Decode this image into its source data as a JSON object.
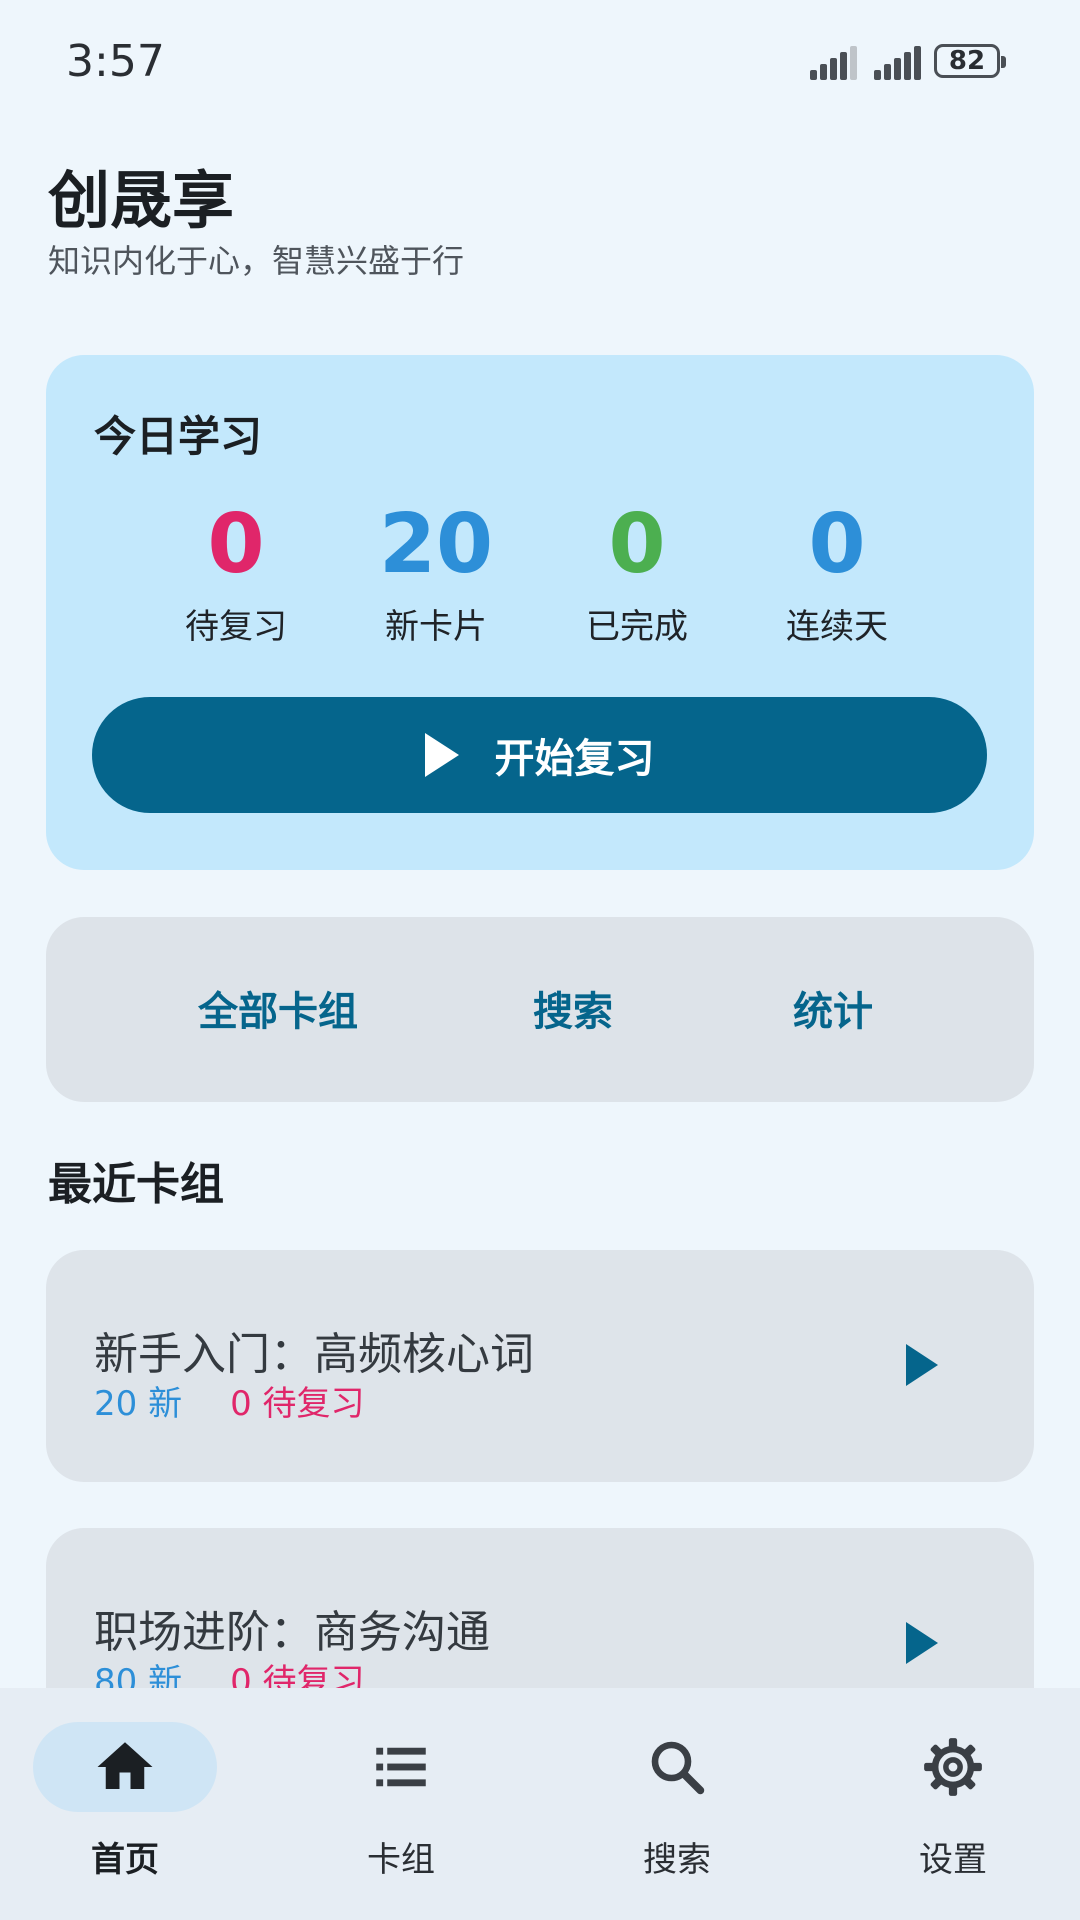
{
  "status_bar": {
    "time": "3:57",
    "battery": "82"
  },
  "header": {
    "title": "创晟享",
    "subtitle": "知识内化于心，智慧兴盛于行"
  },
  "today": {
    "title": "今日学习",
    "stats": [
      {
        "value": "0",
        "label": "待复习",
        "color": "#e0266a"
      },
      {
        "value": "20",
        "label": "新卡片",
        "color": "#2d8fd8"
      },
      {
        "value": "0",
        "label": "已完成",
        "color": "#4caf50"
      },
      {
        "value": "0",
        "label": "连续天",
        "color": "#2d8fd8"
      }
    ],
    "start_button": "开始复习"
  },
  "quick_links": [
    "全部卡组",
    "搜索",
    "统计"
  ],
  "recent": {
    "title": "最近卡组",
    "decks": [
      {
        "name": "新手入门：高频核心词",
        "new": "20 新",
        "due": "0 待复习"
      },
      {
        "name": "职场进阶：商务沟通",
        "new": "80 新",
        "due": "0 待复习"
      }
    ]
  },
  "nav": [
    {
      "label": "首页",
      "icon": "home-icon",
      "active": true
    },
    {
      "label": "卡组",
      "icon": "list-icon",
      "active": false
    },
    {
      "label": "搜索",
      "icon": "search-icon",
      "active": false
    },
    {
      "label": "设置",
      "icon": "gear-icon",
      "active": false
    }
  ],
  "colors": {
    "primary": "#05658c",
    "due": "#e0266a",
    "new": "#2d8fd8",
    "done": "#4caf50"
  }
}
